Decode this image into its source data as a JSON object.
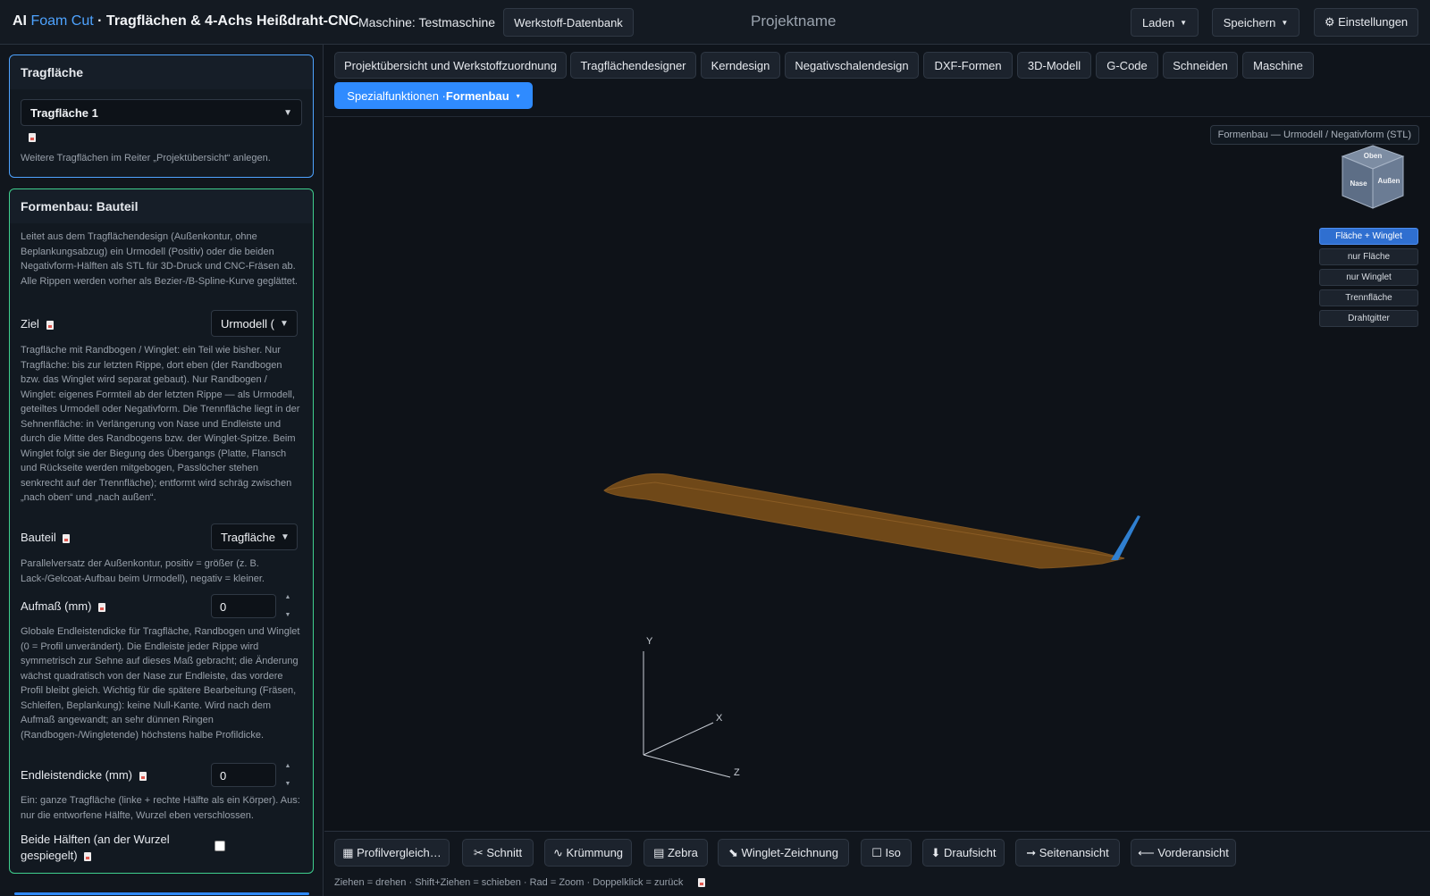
{
  "header": {
    "title_prefix": "AI ",
    "title_brand": "Foam Cut",
    "title_rest": " · Tragflächen & 4-Achs Heißdraht-CNC",
    "machine": "Maschine: Testmaschine",
    "material_db": "Werkstoff-Datenbank",
    "project_name": "Projektname",
    "load": "Laden",
    "save": "Speichern",
    "settings": "⚙ Einstellungen"
  },
  "sidebar": {
    "wing_panel": {
      "title": "Tragfläche",
      "selected": "Tragfläche 1",
      "note": "Weitere Tragflächen im Reiter „Projektübersicht“ anlegen."
    },
    "mold_panel": {
      "title": "Formenbau: Bauteil",
      "intro": "Leitet aus dem Tragflächendesign (Außenkontur, ohne Beplankungsabzug) ein Urmodell (Positiv) oder die beiden Negativform-Hälften als STL für 3D-Druck und CNC-Fräsen ab. Alle Rippen werden vorher als Bezier-/B-Spline-Kurve geglättet.",
      "target_label": "Ziel",
      "target_value": "Urmodell (",
      "target_help": "Tragfläche mit Randbogen / Winglet: ein Teil wie bisher. Nur Tragfläche: bis zur letzten Rippe, dort eben (der Randbogen bzw. das Winglet wird separat gebaut). Nur Randbogen / Winglet: eigenes Formteil ab der letzten Rippe — als Urmodell, geteiltes Urmodell oder Negativform. Die Trennfläche liegt in der Sehnenfläche: in Verlängerung von Nase und Endleiste und durch die Mitte des Randbogens bzw. der Winglet-Spitze. Beim Winglet folgt sie der Biegung des Übergangs (Platte, Flansch und Rückseite werden mitgebogen, Passlöcher stehen senkrecht auf der Trennfläche); entformt wird schräg zwischen „nach oben“ und „nach außen“.",
      "part_label": "Bauteil",
      "part_value": "Tragfläche",
      "offset_help": "Parallelversatz der Außenkontur, positiv = größer (z. B. Lack-/Gelcoat-Aufbau beim Urmodell), negativ = kleiner.",
      "allowance_label": "Aufmaß (mm)",
      "allowance_value": "0",
      "te_help": "Globale Endleistendicke für Tragfläche, Randbogen und Winglet (0 = Profil unverändert). Die Endleiste jeder Rippe wird symmetrisch zur Sehne auf dieses Maß gebracht; die Änderung wächst quadratisch von der Nase zur Endleiste, das vordere Profil bleibt gleich. Wichtig für die spätere Bearbeitung (Fräsen, Schleifen, Beplankung): keine Null-Kante. Wird nach dem Aufmaß angewandt; an sehr dünnen Ringen (Randbogen-/Wingletende) höchstens halbe Profildicke.",
      "te_label": "Endleistendicke (mm)",
      "te_value": "0",
      "both_help": "Ein: ganze Tragfläche (linke + rechte Hälfte als ein Körper). Aus: nur die entworfene Hälfte, Wurzel eben verschlossen.",
      "both_label": "Beide Hälften (an der Wurzel gespiegelt)",
      "both_checked": false
    }
  },
  "tabs": [
    "Projektübersicht und Werkstoffzuordnung",
    "Tragflächendesigner",
    "Kerndesign",
    "Negativschalendesign",
    "DXF-Formen",
    "3D-Modell",
    "G-Code",
    "Schneiden",
    "Maschine"
  ],
  "active_tab": {
    "prefix": "Spezialfunktionen · ",
    "bold": "Formenbau",
    "caret": "▾"
  },
  "viewport": {
    "label": "Formenbau — Urmodell / Negativform (STL)",
    "cube": {
      "top": "Oben",
      "front": "Nase",
      "side": "Außen"
    },
    "view_buttons": [
      "Fläche + Winglet",
      "nur Fläche",
      "nur Winglet",
      "Trennfläche",
      "Drahtgitter"
    ],
    "axes": {
      "x": "X",
      "y": "Y",
      "z": "Z"
    },
    "colors": {
      "wing": "#7a4f1c",
      "winglet": "#2f7fd0",
      "background": "#0e1218"
    }
  },
  "toolbar": {
    "buttons": [
      "▦ Profilvergleich…",
      "✂ Schnitt",
      "∿ Krümmung",
      "▤ Zebra",
      "⬊ Winglet-Zeichnung",
      "☐ Iso",
      "⬇ Draufsicht",
      "➞ Seitenansicht",
      "⟵ Vorderansicht"
    ],
    "hint": "Ziehen = drehen · Shift+Ziehen = schieben · Rad = Zoom · Doppelklick = zurück"
  }
}
